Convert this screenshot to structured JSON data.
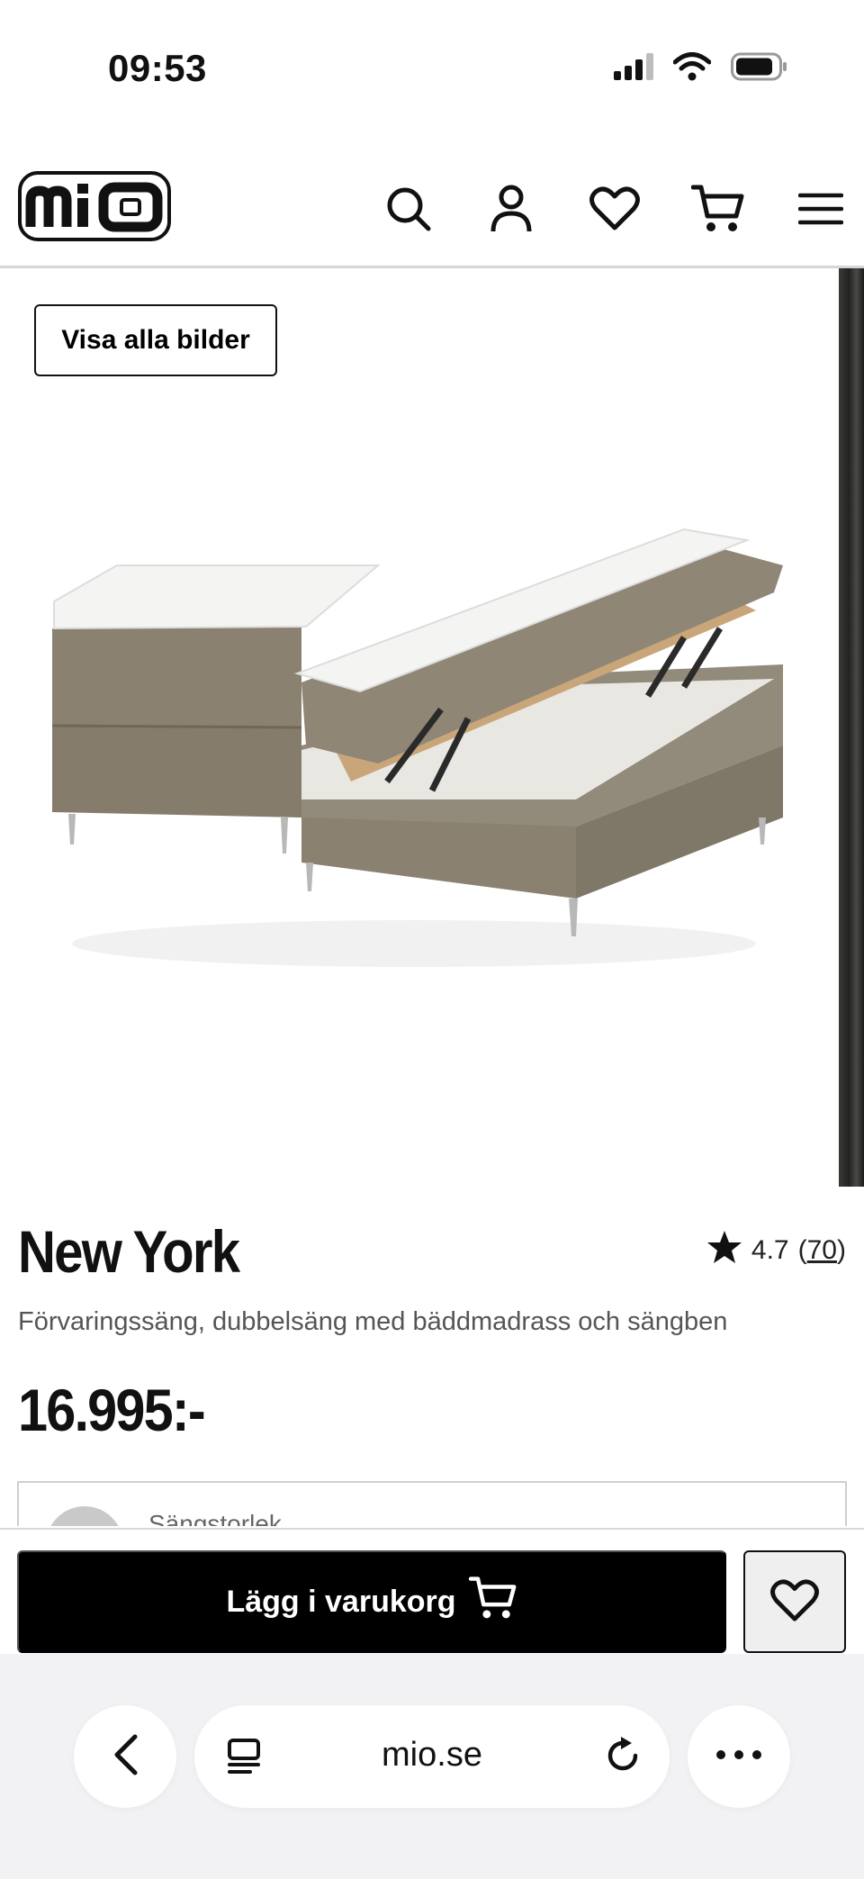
{
  "status_bar": {
    "time": "09:53",
    "icons": [
      "signal-icon",
      "wifi-icon",
      "battery-icon"
    ]
  },
  "header": {
    "logo_text": "mio",
    "icons": [
      "search-icon",
      "account-icon",
      "heart-icon",
      "cart-icon",
      "menu-icon"
    ]
  },
  "gallery": {
    "show_all_label": "Visa alla bilder"
  },
  "product": {
    "title": "New York",
    "rating": "4.7",
    "rating_count": "70",
    "subtitle": "Förvaringssäng, dubbelsäng med bäddmadrass och sängben",
    "price": "16.995:-"
  },
  "size_selector": {
    "label": "Sängstorlek"
  },
  "action_bar": {
    "add_to_cart_label": "Lägg i varukorg"
  },
  "browser": {
    "url": "mio.se"
  },
  "colors": {
    "bed_fabric": "#8b8272",
    "button_bg": "#000000",
    "divider": "#d6d6d6"
  }
}
